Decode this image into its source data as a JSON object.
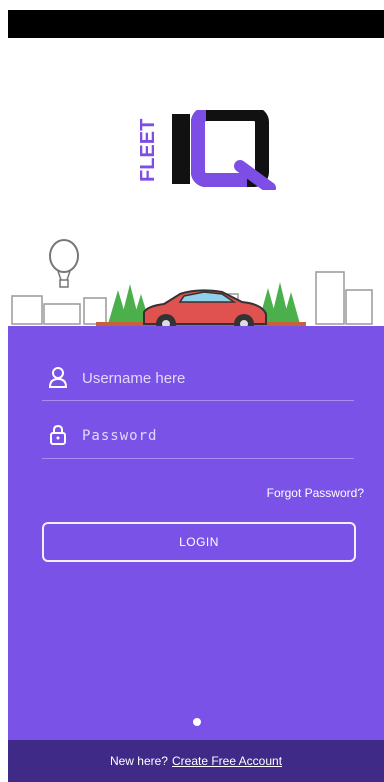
{
  "brand": {
    "fleet": "FLEET",
    "iq": "IQ"
  },
  "form": {
    "username_placeholder": "Username here",
    "password_placeholder": "Password",
    "forgot_label": "Forgot Password?",
    "login_label": "LOGIN"
  },
  "footer": {
    "prompt": "New here?",
    "link_label": "Create Free Account"
  },
  "icons": {
    "username": "user-icon",
    "password": "lock-icon",
    "balloon": "hot-air-balloon-icon",
    "car": "car-icon"
  },
  "colors": {
    "accent": "#7b52e8",
    "footer": "#3f2a87",
    "logo_purple": "#7c4ee6",
    "car_red": "#e0524f"
  }
}
